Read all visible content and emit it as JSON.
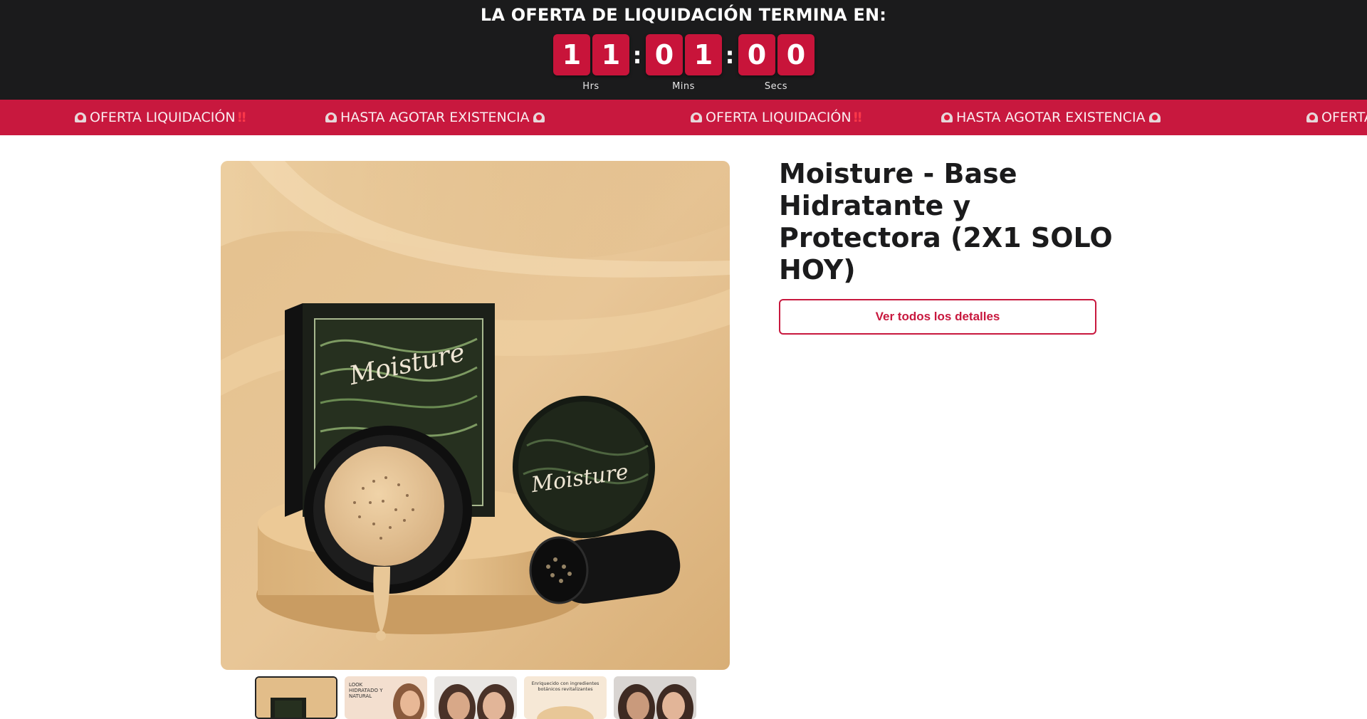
{
  "countdown": {
    "title": "LA OFERTA DE LIQUIDACIÓN TERMINA EN:",
    "hours": [
      "1",
      "1"
    ],
    "minutes": [
      "0",
      "1"
    ],
    "seconds": [
      "0",
      "0"
    ],
    "separator": ":",
    "labels": {
      "hours": "Hrs",
      "minutes": "Mins",
      "seconds": "Secs"
    }
  },
  "marquee": {
    "items": [
      "OFERTA LIQUIDACIÓN",
      "HASTA AGOTAR EXISTENCIA",
      "OFERTA LIQUIDACIÓN",
      "HASTA AGOTAR EXISTENCIA",
      "OFERTA"
    ],
    "icons": [
      "siren-icon",
      "double-exclamation-icon"
    ]
  },
  "product": {
    "title": "Moisture - Base Hidratante y Protectora (2X1 SOLO HOY)",
    "details_button": "Ver todos los detalles",
    "brand_on_image": "Moisture",
    "thumbnails": [
      {
        "name": "thumbnail-1",
        "text": ""
      },
      {
        "name": "thumbnail-2",
        "text": "LOOK HIDRATADO Y NATURAL"
      },
      {
        "name": "thumbnail-3",
        "text": ""
      },
      {
        "name": "thumbnail-4",
        "text": "Enriquecido con ingredientes botánicos revitalizantes"
      },
      {
        "name": "thumbnail-5",
        "text": ""
      }
    ]
  },
  "colors": {
    "countdown_bg": "#1b1b1c",
    "accent_red": "#c8183e",
    "text_dark": "#1b1b1c"
  }
}
